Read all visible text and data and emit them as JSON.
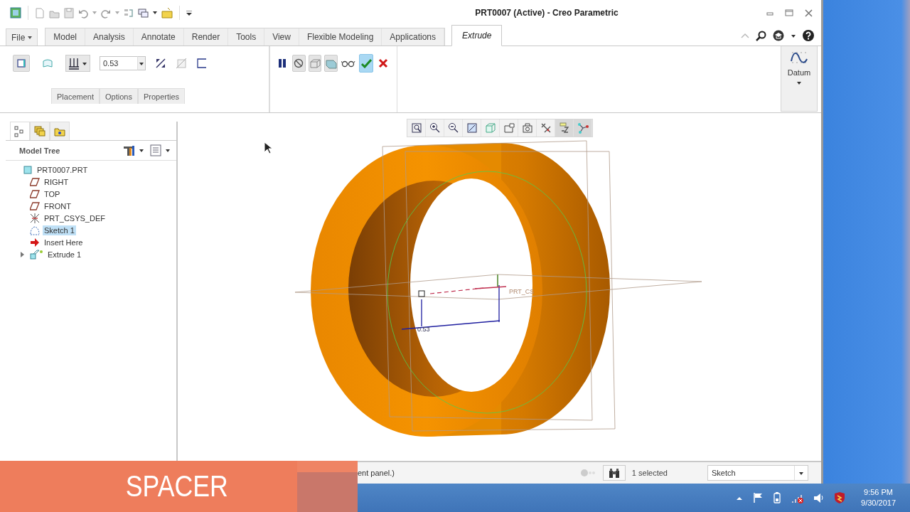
{
  "window": {
    "title": "PRT0007 (Active) - Creo Parametric"
  },
  "ribbon_tabs": [
    {
      "label": "File",
      "selected": false,
      "kind": "menu"
    },
    {
      "label": "Model",
      "selected": false,
      "kind": "tab"
    },
    {
      "label": "Analysis",
      "selected": false,
      "kind": "tab"
    },
    {
      "label": "Annotate",
      "selected": false,
      "kind": "tab"
    },
    {
      "label": "Render",
      "selected": false,
      "kind": "tab"
    },
    {
      "label": "Tools",
      "selected": false,
      "kind": "tab"
    },
    {
      "label": "View",
      "selected": false,
      "kind": "tab"
    },
    {
      "label": "Flexible Modeling",
      "selected": false,
      "kind": "tab"
    },
    {
      "label": "Applications",
      "selected": false,
      "kind": "tab"
    },
    {
      "label": "Extrude",
      "selected": true,
      "kind": "tab"
    }
  ],
  "extrude_dashboard": {
    "depth_field": {
      "value": "0.53"
    },
    "panel_tabs": [
      {
        "label": "Placement"
      },
      {
        "label": "Options"
      },
      {
        "label": "Properties"
      }
    ]
  },
  "datum_group": {
    "label": "Datum"
  },
  "model_tree": {
    "title": "Model Tree",
    "items": [
      {
        "label": "PRT0007.PRT",
        "kind": "part",
        "selected": false,
        "children": [
          {
            "label": "RIGHT",
            "kind": "plane",
            "selected": false
          },
          {
            "label": "TOP",
            "kind": "plane",
            "selected": false
          },
          {
            "label": "FRONT",
            "kind": "plane",
            "selected": false
          },
          {
            "label": "PRT_CSYS_DEF",
            "kind": "csys",
            "selected": false
          },
          {
            "label": "Sketch 1",
            "kind": "sketch",
            "selected": true
          },
          {
            "label": "Insert Here",
            "kind": "insert",
            "selected": false
          },
          {
            "label": "Extrude 1",
            "kind": "extrude",
            "selected": false,
            "expanded": false
          }
        ]
      }
    ]
  },
  "viewport": {
    "dimension": "0.53",
    "csys_label": "PRT_CS"
  },
  "status_bar": {
    "message": "ent panel.)",
    "selection": "1 selected",
    "filter": "Sketch"
  },
  "taskbar": {
    "time": "9:56 PM",
    "date": "9/30/2017"
  },
  "caption": {
    "text": "SPACER"
  }
}
